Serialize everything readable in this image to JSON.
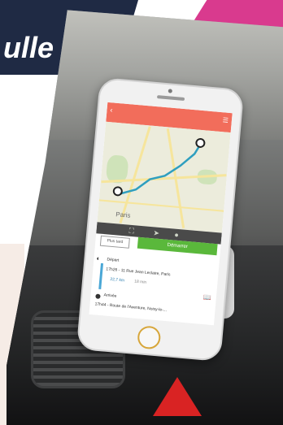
{
  "overlay": {
    "banner_text": "ulle"
  },
  "phone_app": {
    "header": {
      "title": "",
      "subtitle": ""
    },
    "map": {
      "city_label": "Paris"
    },
    "buttons": {
      "later_label": "Plus tard",
      "go_label": "Démarrer"
    },
    "route": {
      "departure_label": "Départ",
      "departure_time_address": "17h26 - 11 Rue Jean Leclaire, Paris",
      "distance": "22,7 km",
      "duration": "18 min",
      "arrival_label": "Arrivée",
      "arrival_time_address": "17h44 - Route de l'Aventure, Noisy-le-..."
    }
  },
  "colors": {
    "banner": "#1f2a44",
    "pink": "#d93a8e",
    "app_header": "#f26d5b",
    "go_button": "#5ab83b",
    "route_line": "#4aa7d6",
    "warning": "#d92323"
  }
}
